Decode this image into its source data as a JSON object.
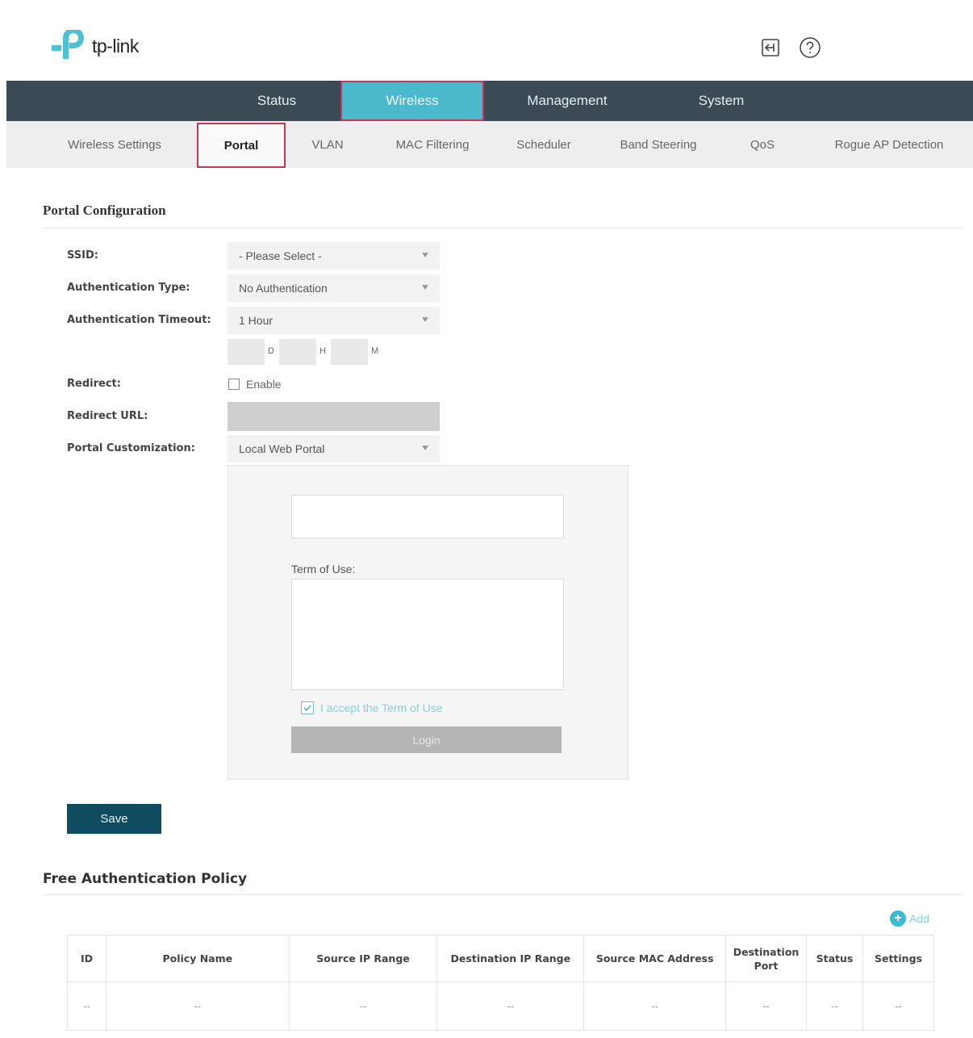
{
  "header": {
    "logo_text": "tp-link",
    "logout_icon": "logout-icon",
    "help_icon": "help-icon"
  },
  "main_nav": {
    "tabs": [
      {
        "label": "Status",
        "active": false
      },
      {
        "label": "Wireless",
        "active": true
      },
      {
        "label": "Management",
        "active": false
      },
      {
        "label": "System",
        "active": false
      }
    ]
  },
  "sub_nav": {
    "items": [
      {
        "label": "Wireless Settings",
        "active": false
      },
      {
        "label": "Portal",
        "active": true
      },
      {
        "label": "VLAN",
        "active": false
      },
      {
        "label": "MAC Filtering",
        "active": false
      },
      {
        "label": "Scheduler",
        "active": false
      },
      {
        "label": "Band Steering",
        "active": false
      },
      {
        "label": "QoS",
        "active": false
      },
      {
        "label": "Rogue AP Detection",
        "active": false
      }
    ]
  },
  "portal_config": {
    "title": "Portal Configuration",
    "ssid": {
      "label": "SSID:",
      "value": "- Please Select -"
    },
    "auth_type": {
      "label": "Authentication Type:",
      "value": "No Authentication"
    },
    "auth_timeout": {
      "label": "Authentication Timeout:",
      "value": "1 Hour",
      "units": {
        "d": "D",
        "h": "H",
        "m": "M"
      }
    },
    "redirect": {
      "label": "Redirect:",
      "checkbox_label": "Enable",
      "checked": false
    },
    "redirect_url": {
      "label": "Redirect URL:",
      "value": ""
    },
    "portal_customization": {
      "label": "Portal Customization:",
      "value": "Local Web Portal"
    },
    "preview": {
      "terms_label": "Term of Use:",
      "accept_label": "I accept the Term of Use",
      "accept_checked": true,
      "login_label": "Login"
    },
    "save_label": "Save"
  },
  "free_auth_policy": {
    "title": "Free Authentication Policy",
    "add_label": "Add",
    "columns": [
      "ID",
      "Policy Name",
      "Source IP Range",
      "Destination IP Range",
      "Source MAC Address",
      "Destination Port",
      "Status",
      "Settings"
    ],
    "rows": [
      [
        "--",
        "--",
        "--",
        "--",
        "--",
        "--",
        "--",
        "--"
      ]
    ]
  },
  "colors": {
    "nav_bg": "#3b4a55",
    "active_tab_bg": "#4bb8cc",
    "highlight_border": "#c8375a",
    "save_button": "#0f4c60",
    "accent": "#3cbad0"
  }
}
